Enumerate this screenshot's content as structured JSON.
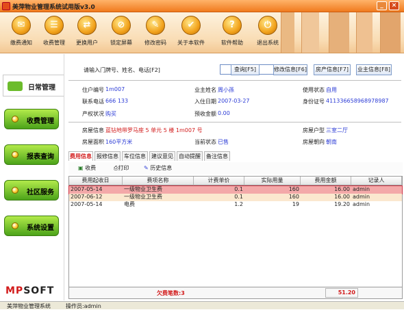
{
  "window": {
    "title": "美萍物业管理系统试用版v3.0",
    "min": "_",
    "close": "×"
  },
  "toolbar": [
    {
      "label": "缴费通知",
      "icon": "notice-icon",
      "glyph": "✉"
    },
    {
      "label": "收费管理",
      "icon": "clipboard-icon",
      "glyph": "☰"
    },
    {
      "label": "更换用户",
      "icon": "switch-user-icon",
      "glyph": "⇄"
    },
    {
      "label": "锁定屏幕",
      "icon": "lock-screen-icon",
      "glyph": "⊘"
    },
    {
      "label": "修改密码",
      "icon": "key-icon",
      "glyph": "✎"
    },
    {
      "label": "关于本软件",
      "icon": "about-icon",
      "glyph": "✔"
    },
    {
      "label": "软件帮助",
      "icon": "help-icon",
      "glyph": "?"
    },
    {
      "label": "退出系统",
      "icon": "power-icon",
      "glyph": "⏻"
    }
  ],
  "sidebar": {
    "active": "日常管理",
    "items": [
      "收费管理",
      "报表查询",
      "社区服务",
      "系统设置"
    ]
  },
  "logo": {
    "a": "MP",
    "b": "SOFT"
  },
  "search": {
    "label": "请输入门牌号、姓名、电话[F2]",
    "value": ""
  },
  "buttons": {
    "query": "查询[F5]",
    "modify": "修改信息[F6]",
    "property": "房产信息[F7]",
    "owner": "业主信息[F8]"
  },
  "info": {
    "user_no_label": "住户编号",
    "user_no": "1m007",
    "owner_name_label": "业主姓名",
    "owner_name": "周小孫",
    "use_status_label": "使用状态",
    "use_status": "自用",
    "phone_label": "联系电话",
    "phone": "666 133",
    "move_in_label": "入住日期",
    "move_in": "2007-03-27",
    "id_label": "身份证号",
    "id": "411336658968978987",
    "ownership_label": "产权状况",
    "ownership": "购买",
    "prepaid_label": "预收金额",
    "prepaid": "0.00",
    "house_info_label": "房屋信息",
    "house_info": "蓝钻地带罗马座 5 单元 5 楼 1m007 号",
    "house_type_label": "房屋户型",
    "house_type": "三室二厅",
    "area_label": "房屋面积",
    "area": "160平方米",
    "current_status_label": "当前状态",
    "current_status": "已售",
    "orientation_label": "房屋朝向",
    "orientation": "朝南"
  },
  "tabs": [
    "费用信息",
    "报修信息",
    "车位信息",
    "建议意见",
    "自动提醒",
    "备注信息"
  ],
  "subtools": [
    {
      "label": "收费",
      "icon": "charge-icon"
    },
    {
      "label": "打印",
      "icon": "print-icon"
    },
    {
      "label": "历史信息",
      "icon": "history-icon"
    }
  ],
  "table": {
    "columns": [
      "费用起收日",
      "费项名称",
      "计费单价",
      "实际用量",
      "费用金额",
      "记录人"
    ],
    "rows": [
      {
        "date": "2007-05-14",
        "name": "一级物业卫生费",
        "price": "0.1",
        "qty": "160",
        "amount": "16.00",
        "rec": "admin"
      },
      {
        "date": "2007-06-12",
        "name": "一级物业卫生费",
        "price": "0.1",
        "qty": "160",
        "amount": "16.00",
        "rec": "admin"
      },
      {
        "date": "2007-05-14",
        "name": "电费",
        "price": "1.2",
        "qty": "19",
        "amount": "19.20",
        "rec": "admin"
      }
    ],
    "footer_count": "欠费笔数:3",
    "footer_total": "51.20"
  },
  "status": {
    "app": "美萍物业管理系统",
    "operator": "操作员:admin"
  },
  "colors": {
    "title": "#f07a1e",
    "accent_green": "#6cbc2c",
    "highlight_red": "#d21b1b",
    "link_blue": "#2b3bd6",
    "row_selected": "#f3a9a9",
    "row_alt": "#fbe8cf"
  }
}
